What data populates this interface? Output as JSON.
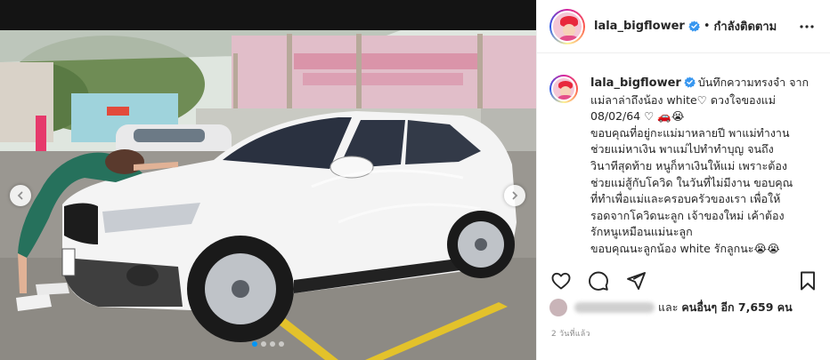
{
  "post": {
    "username": "lala_bigflower",
    "verified": true,
    "follow_separator": "•",
    "follow_label": "กำลังติดตาม",
    "more_icon": "more-horizontal-icon",
    "caption_lines": [
      "บันทึกความทรงจำ จาก",
      "แม่ลาล่าถึงน้อง white♡ ดวงใจของแม่",
      "08/02/64 ♡ 🚗😭",
      "ขอบคุณที่อยู่กะแม่มาหลายปี พาแม่ทำงาน",
      "ช่วยแม่หาเงิน พาแม่ไปทำทำบุญ จนถึง",
      "วินาทีสุดท้าย หนูก็หาเงินให้แม่ เพราะต้อง",
      "ช่วยแม่สู้กับโควิด ในวันที่ไม่มีงาน ขอบคุณ",
      "ที่ทำเพื่อแม่และครอบครัวของเรา เพื่อให้",
      "รอดจากโควิดนะลูก เจ้าของใหม่ เค้าต้อง",
      "รักหนูเหมือนแม่นะลูก",
      "ขอบคุณนะลูกน้อง white รักลูกนะ😭😭"
    ],
    "likes_prefix": "และ",
    "likes_others": "คนอื่นๆ อีก 7,659 คน",
    "timestamp": "2 วันที่แล้ว",
    "carousel": {
      "total": 4,
      "active_index": 0
    }
  },
  "icons": {
    "like": "heart-icon",
    "comment": "comment-icon",
    "share": "share-icon",
    "save": "bookmark-icon"
  },
  "colors": {
    "accent": "#0095f6",
    "verified": "#3897f0",
    "text": "#262626",
    "muted": "#8e8e8e"
  }
}
